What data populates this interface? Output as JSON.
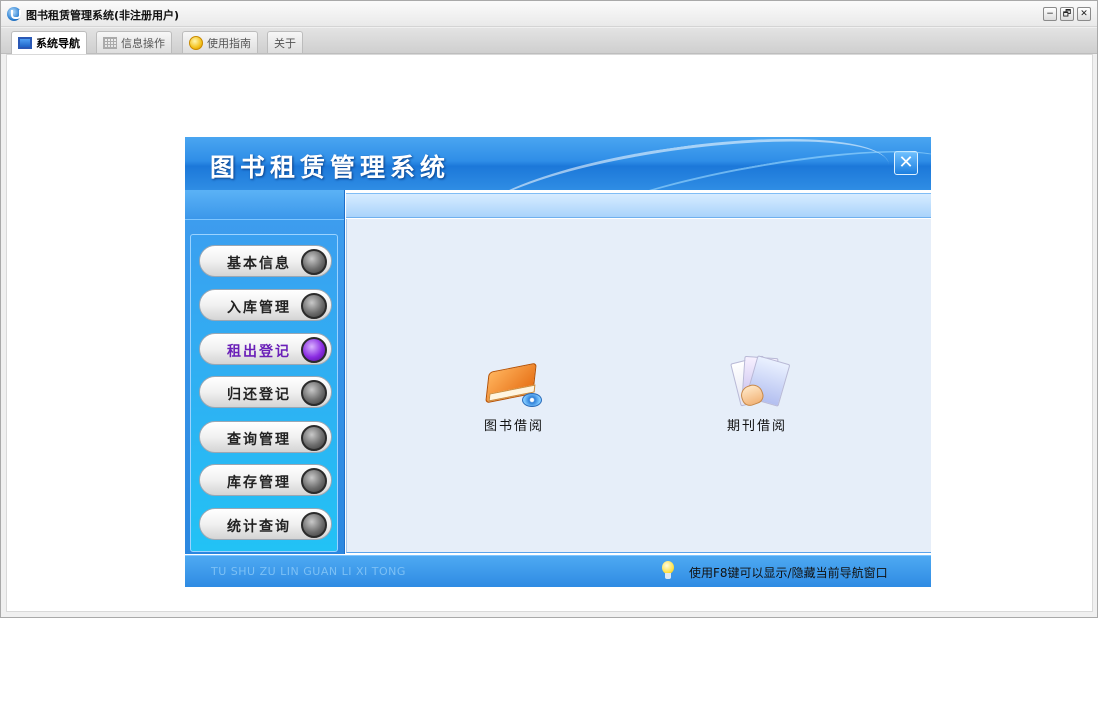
{
  "window": {
    "title": "图书租赁管理系统(非注册用户)",
    "controls": {
      "minimize": "−",
      "restore": "🗗",
      "close": "✕"
    }
  },
  "tabs": [
    {
      "label": "系统导航",
      "icon": "monitor-icon",
      "active": true
    },
    {
      "label": "信息操作",
      "icon": "grid-icon",
      "active": false
    },
    {
      "label": "使用指南",
      "icon": "help-icon",
      "active": false
    },
    {
      "label": "关于",
      "icon": "",
      "active": false
    }
  ],
  "nav": {
    "title": "图书租赁管理系统",
    "close_glyph": "✕",
    "menu": [
      {
        "label": "基本信息",
        "active": false
      },
      {
        "label": "入库管理",
        "active": false
      },
      {
        "label": "租出登记",
        "active": true
      },
      {
        "label": "归还登记",
        "active": false
      },
      {
        "label": "查询管理",
        "active": false
      },
      {
        "label": "库存管理",
        "active": false
      },
      {
        "label": "统计查询",
        "active": false
      }
    ],
    "functions": [
      {
        "label": "图书借阅",
        "icon": "book-icon"
      },
      {
        "label": "期刊借阅",
        "icon": "periodical-icon"
      }
    ],
    "footer": {
      "pinyin": "TU SHU ZU LIN  GUAN LI XI TONG",
      "tip": "使用F8键可以显示/隐藏当前导航窗口"
    }
  },
  "colors": {
    "header_blue": "#2f8ee7",
    "panel_body": "#e6eef9",
    "active_menu": "#6a1fb8"
  }
}
